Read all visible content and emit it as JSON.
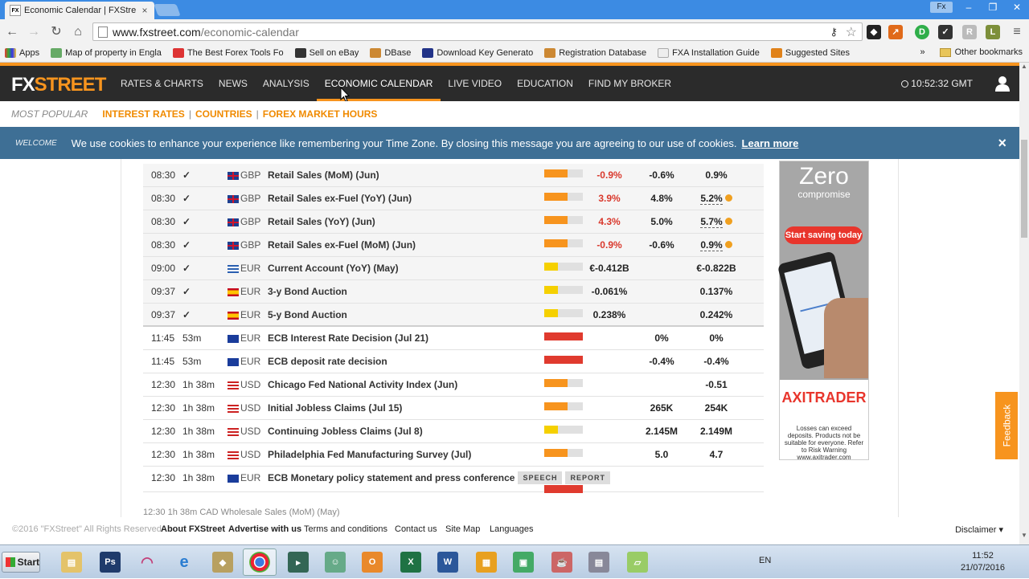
{
  "browser": {
    "tab_title": "Economic Calendar | FXStre",
    "tab_favicon": "FX",
    "url_host": "www.fxstreet.com",
    "url_path": "/economic-calendar",
    "profile_label": "Fx",
    "bookmarks": [
      "Apps",
      "Map of property in Engla",
      "The Best Forex Tools Fo",
      "Sell on eBay",
      "DBase",
      "Download Key Generato",
      "Registration Database",
      "FXA Installation Guide",
      "Suggested Sites"
    ],
    "bookmarks_overflow": "»",
    "other_bookmarks": "Other bookmarks"
  },
  "site": {
    "logo_fx": "FX",
    "logo_street": "STREET",
    "nav": [
      "RATES & CHARTS",
      "NEWS",
      "ANALYSIS",
      "ECONOMIC CALENDAR",
      "LIVE VIDEO",
      "EDUCATION",
      "FIND MY BROKER"
    ],
    "active_nav": "ECONOMIC CALENDAR",
    "clock": "10:52:32 GMT",
    "most_popular": "MOST POPULAR",
    "sub_links": [
      "INTEREST RATES",
      "COUNTRIES",
      "FOREX MARKET HOURS"
    ],
    "cookie_welcome": "WELCOME",
    "cookie_message": "We use cookies to enhance your experience like remembering your Time Zone. By closing this message you are agreeing to our use of cookies.",
    "cookie_learn_more": "Learn more",
    "cookie_close": "×"
  },
  "events": [
    {
      "time": "08:30",
      "status": "✓",
      "currency": "GBP",
      "flag": "uk",
      "event": "Retail Sales (MoM) (Jun)",
      "impact": "medium",
      "actual": "-0.9%",
      "actual_color": "red",
      "consensus": "-0.6%",
      "previous": "0.9%",
      "revised": false,
      "past": true
    },
    {
      "time": "08:30",
      "status": "✓",
      "currency": "GBP",
      "flag": "uk",
      "event": "Retail Sales ex-Fuel (YoY) (Jun)",
      "impact": "medium",
      "actual": "3.9%",
      "actual_color": "red",
      "consensus": "4.8%",
      "previous": "5.2%",
      "revised": true,
      "past": true
    },
    {
      "time": "08:30",
      "status": "✓",
      "currency": "GBP",
      "flag": "uk",
      "event": "Retail Sales (YoY) (Jun)",
      "impact": "medium",
      "actual": "4.3%",
      "actual_color": "red",
      "consensus": "5.0%",
      "previous": "5.7%",
      "revised": true,
      "past": true
    },
    {
      "time": "08:30",
      "status": "✓",
      "currency": "GBP",
      "flag": "uk",
      "event": "Retail Sales ex-Fuel (MoM) (Jun)",
      "impact": "medium",
      "actual": "-0.9%",
      "actual_color": "red",
      "consensus": "-0.6%",
      "previous": "0.9%",
      "revised": true,
      "past": true
    },
    {
      "time": "09:00",
      "status": "✓",
      "currency": "EUR",
      "flag": "gr",
      "event": "Current Account (YoY) (May)",
      "impact": "low",
      "actual": "€-0.412B",
      "actual_color": "black",
      "consensus": "",
      "previous": "€-0.822B",
      "revised": false,
      "past": true
    },
    {
      "time": "09:37",
      "status": "✓",
      "currency": "EUR",
      "flag": "es",
      "event": "3-y Bond Auction",
      "impact": "low",
      "actual": "-0.061%",
      "actual_color": "black",
      "consensus": "",
      "previous": "0.137%",
      "revised": false,
      "past": true
    },
    {
      "time": "09:37",
      "status": "✓",
      "currency": "EUR",
      "flag": "es",
      "event": "5-y Bond Auction",
      "impact": "low",
      "actual": "0.238%",
      "actual_color": "black",
      "consensus": "",
      "previous": "0.242%",
      "revised": false,
      "past": true
    },
    {
      "time": "11:45",
      "status": "53m",
      "currency": "EUR",
      "flag": "eu",
      "event": "ECB Interest Rate Decision (Jul 21)",
      "impact": "high",
      "actual": "",
      "actual_color": "black",
      "consensus": "0%",
      "previous": "0%",
      "revised": false,
      "past": false
    },
    {
      "time": "11:45",
      "status": "53m",
      "currency": "EUR",
      "flag": "eu",
      "event": "ECB deposit rate decision",
      "impact": "high",
      "actual": "",
      "actual_color": "black",
      "consensus": "-0.4%",
      "previous": "-0.4%",
      "revised": false,
      "past": false
    },
    {
      "time": "12:30",
      "status": "1h 38m",
      "currency": "USD",
      "flag": "us",
      "event": "Chicago Fed National Activity Index (Jun)",
      "impact": "medium",
      "actual": "",
      "actual_color": "black",
      "consensus": "",
      "previous": "-0.51",
      "revised": false,
      "past": false
    },
    {
      "time": "12:30",
      "status": "1h 38m",
      "currency": "USD",
      "flag": "us",
      "event": "Initial Jobless Claims (Jul 15)",
      "impact": "medium",
      "actual": "",
      "actual_color": "black",
      "consensus": "265K",
      "previous": "254K",
      "revised": false,
      "past": false
    },
    {
      "time": "12:30",
      "status": "1h 38m",
      "currency": "USD",
      "flag": "us",
      "event": "Continuing Jobless Claims (Jul 8)",
      "impact": "low",
      "actual": "",
      "actual_color": "black",
      "consensus": "2.145M",
      "previous": "2.149M",
      "revised": false,
      "past": false
    },
    {
      "time": "12:30",
      "status": "1h 38m",
      "currency": "USD",
      "flag": "us",
      "event": "Philadelphia Fed Manufacturing Survey (Jul)",
      "impact": "medium",
      "actual": "",
      "actual_color": "black",
      "consensus": "5.0",
      "previous": "4.7",
      "revised": false,
      "past": false
    },
    {
      "time": "12:30",
      "status": "1h 38m",
      "currency": "EUR",
      "flag": "eu",
      "event": "ECB Monetary policy statement and press conference",
      "impact": "high",
      "actual": "",
      "actual_color": "black",
      "consensus": "",
      "previous": "",
      "revised": false,
      "past": false,
      "tags": [
        "SPEECH",
        "REPORT"
      ]
    }
  ],
  "impact_colors": {
    "low": "#f5d000",
    "medium": "#f7941e",
    "high": "#e03a2e"
  },
  "ad": {
    "headline": "Zero",
    "subhead": "compromise",
    "cta": "Start saving today",
    "brand": "AXITRADER",
    "disclaimer": "Losses can exceed deposits. Products not be suitable for everyone. Refer to Risk Warning www.axitrader.com"
  },
  "feedback_label": "Feedback",
  "footer": {
    "copyright": "©2016 \"FXStreet\" All Rights Reserved",
    "links": [
      "About FXStreet",
      "Advertise with us",
      "Terms and conditions",
      "Contact us",
      "Site Map",
      "Languages"
    ],
    "disclaimer": "Disclaimer ▾"
  },
  "partial_row_text": "12:30   1h 38m   CAD   Wholesale Sales (MoM) (May)",
  "taskbar": {
    "start_label": "Start",
    "language": "EN",
    "time": "11:52",
    "date": "21/07/2016"
  }
}
